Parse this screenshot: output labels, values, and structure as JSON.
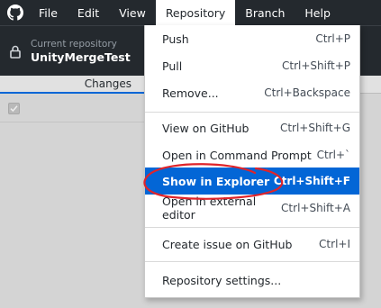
{
  "menubar": {
    "items": [
      "File",
      "Edit",
      "View",
      "Repository",
      "Branch",
      "Help"
    ],
    "active": "Repository"
  },
  "toolbar": {
    "current_repository_label": "Current repository",
    "current_repository_name": "UnityMergeTest"
  },
  "tabs": {
    "changes_label": "Changes"
  },
  "dropdown": {
    "items": [
      {
        "label": "Push",
        "shortcut": "Ctrl+P"
      },
      {
        "label": "Pull",
        "shortcut": "Ctrl+Shift+P"
      },
      {
        "label": "Remove...",
        "shortcut": "Ctrl+Backspace"
      },
      {
        "label": "View on GitHub",
        "shortcut": "Ctrl+Shift+G"
      },
      {
        "label": "Open in Command Prompt",
        "shortcut": "Ctrl+`"
      },
      {
        "label": "Show in Explorer",
        "shortcut": "Ctrl+Shift+F"
      },
      {
        "label": "Open in external editor",
        "shortcut": "Ctrl+Shift+A"
      },
      {
        "label": "Create issue on GitHub",
        "shortcut": "Ctrl+I"
      },
      {
        "label": "Repository settings...",
        "shortcut": ""
      }
    ],
    "highlighted": "Show in Explorer"
  },
  "colors": {
    "menubar_bg": "#24292e",
    "highlight_bg": "#0366d6",
    "annotation_stroke": "#e0242a"
  },
  "icons": [
    "github-logo-icon",
    "lock-icon",
    "checkbox-check-icon"
  ]
}
